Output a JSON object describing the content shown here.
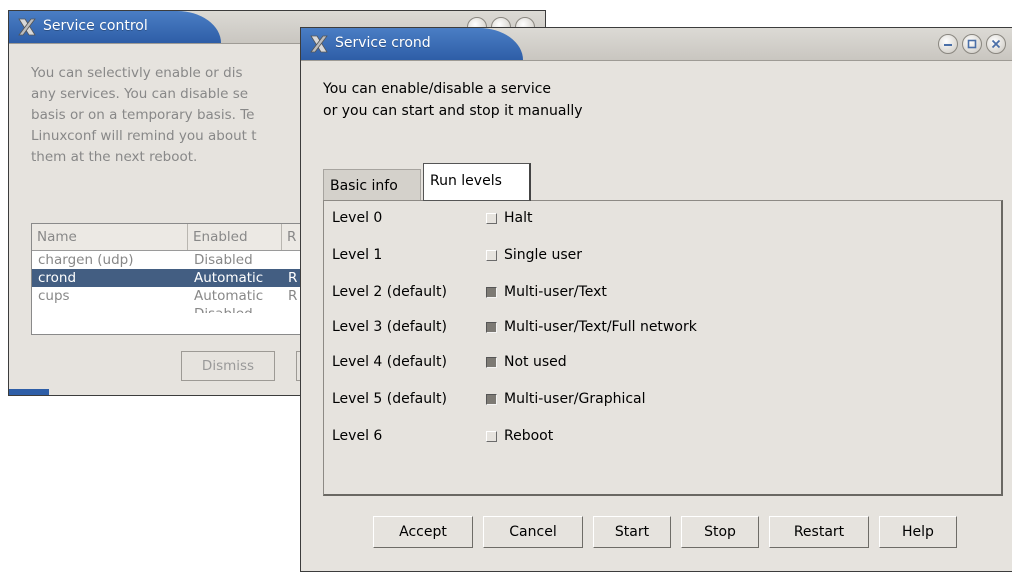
{
  "colors": {
    "title_blue": "#2e5ea7",
    "selection": "#435e82",
    "window_bg": "#e6e3de"
  },
  "control_window": {
    "title": "Service control",
    "icons": [
      "x-logo-icon",
      "minimize-icon",
      "maximize-icon",
      "close-icon"
    ],
    "description_lines": [
      "You can selectivly enable or dis",
      "any services. You can disable se",
      "basis or on a temporary basis. Te",
      "Linuxconf will remind you about t",
      "them at the next reboot."
    ],
    "columns": [
      "Name",
      "Enabled",
      "R"
    ],
    "rows": [
      {
        "name": "chargen (udp)",
        "enabled": "Disabled",
        "r": ""
      },
      {
        "name": "crond",
        "enabled": "Automatic",
        "r": "R"
      },
      {
        "name": "cups",
        "enabled": "Automatic",
        "r": "R"
      },
      {
        "name": "",
        "enabled": "Disabled",
        "r": ""
      }
    ],
    "dismiss_label": "Dismiss"
  },
  "crond_window": {
    "title": "Service crond",
    "intro_lines": [
      "You can enable/disable a service",
      "or you can start and stop it manually"
    ],
    "tabs": [
      {
        "label": "Basic info",
        "active": false
      },
      {
        "label": "Run levels",
        "active": true
      }
    ],
    "levels": [
      {
        "name": "Level 0",
        "checked": false,
        "label": "Halt"
      },
      {
        "name": "Level 1",
        "checked": false,
        "label": "Single user"
      },
      {
        "name": "Level 2 (default)",
        "checked": true,
        "label": "Multi-user/Text"
      },
      {
        "name": "Level 3 (default)",
        "checked": true,
        "label": "Multi-user/Text/Full network"
      },
      {
        "name": "Level 4 (default)",
        "checked": true,
        "label": "Not used"
      },
      {
        "name": "Level 5 (default)",
        "checked": true,
        "label": "Multi-user/Graphical"
      },
      {
        "name": "Level 6",
        "checked": false,
        "label": "Reboot"
      }
    ],
    "buttons": {
      "accept": "Accept",
      "cancel": "Cancel",
      "start": "Start",
      "stop": "Stop",
      "restart": "Restart",
      "help": "Help"
    }
  }
}
